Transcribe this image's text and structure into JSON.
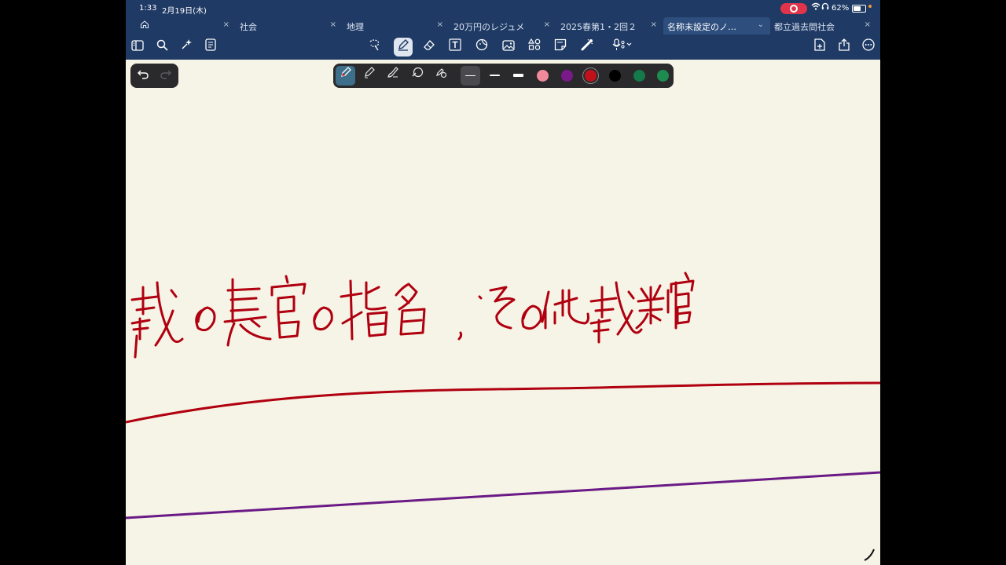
{
  "status_bar": {
    "time": "1:33",
    "date": "2月19日(木)",
    "wifi_icon": "wifi-icon",
    "headphones_icon": "headphones-icon",
    "battery_percent": "62%",
    "battery_level": 0.62,
    "recording_color": "#e0344a"
  },
  "tabs": [
    {
      "label": "",
      "icon": "home-icon",
      "close": "×"
    },
    {
      "label": "社会",
      "close": "×"
    },
    {
      "label": "地理",
      "close": "×"
    },
    {
      "label": "20万円のレジュメ",
      "close": "×"
    },
    {
      "label": "2025春第1・2回２",
      "close": "×"
    },
    {
      "label": "名称未設定のノ…",
      "close": "⌄",
      "active": true
    },
    {
      "label": "都立過去問社会",
      "close": "×"
    }
  ],
  "toolbar": {
    "left_icons": [
      "sidebar-icon",
      "search-icon",
      "ai-assist-icon",
      "page-list-icon"
    ],
    "center_icons": [
      "lasso-icon",
      "pen-icon",
      "eraser-icon",
      "text-box-icon",
      "sticker-icon",
      "image-icon",
      "shapes-icon",
      "sticky-note-icon",
      "laser-pointer-icon",
      "microphone-icon"
    ],
    "right_icons": [
      "add-page-icon",
      "share-icon",
      "more-icon"
    ],
    "selected_tool": "pen-icon"
  },
  "pen_palette": {
    "pen_types": [
      "fountain-pen-icon",
      "ball-pen-icon",
      "brush-pen-icon",
      "shape-pen-icon",
      "handwriting-settings-icon"
    ],
    "selected_pen": "fountain-pen-icon",
    "thicknesses": [
      "thin",
      "medium",
      "thick"
    ],
    "selected_thickness": "thin",
    "colors": [
      "#f08a9a",
      "#7a1a8a",
      "#c0101a",
      "#000000",
      "#157a4a",
      "#1e8c50"
    ],
    "selected_color": "#c0101a"
  },
  "canvas": {
    "background": "#f6f4e6",
    "handwriting": "裁の長官の指名 ．その他裁判官",
    "ink_color": "#b00010",
    "line_colors": [
      "#b00010",
      "#6a1a86"
    ]
  },
  "undo": {
    "undo_icon": "undo-icon",
    "redo_icon": "redo-icon"
  }
}
